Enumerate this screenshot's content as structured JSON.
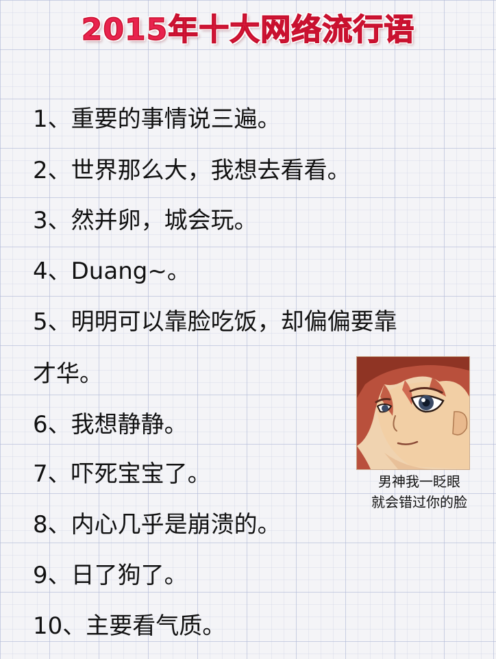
{
  "title": "2015年十大网络流行语",
  "items": [
    "1、重要的事情说三遍。",
    "2、世界那么大，我想去看看。",
    "3、然并卵，城会玩。",
    "4、Duang~。",
    "5、明明可以靠脸吃饭，却偏偏要靠",
    "才华。",
    "6、我想静静。",
    "7、吓死宝宝了。",
    "8、内心几乎是崩溃的。",
    "9、日了狗了。",
    "10、主要看气质。"
  ],
  "caption": {
    "line1": "男神我一眨眼",
    "line2": "就会错过你的脸"
  },
  "colors": {
    "title": "#e8234e",
    "text": "#111111",
    "grid": "#b0b8d6"
  },
  "image": {
    "icon": "anime-boy-face-icon"
  }
}
